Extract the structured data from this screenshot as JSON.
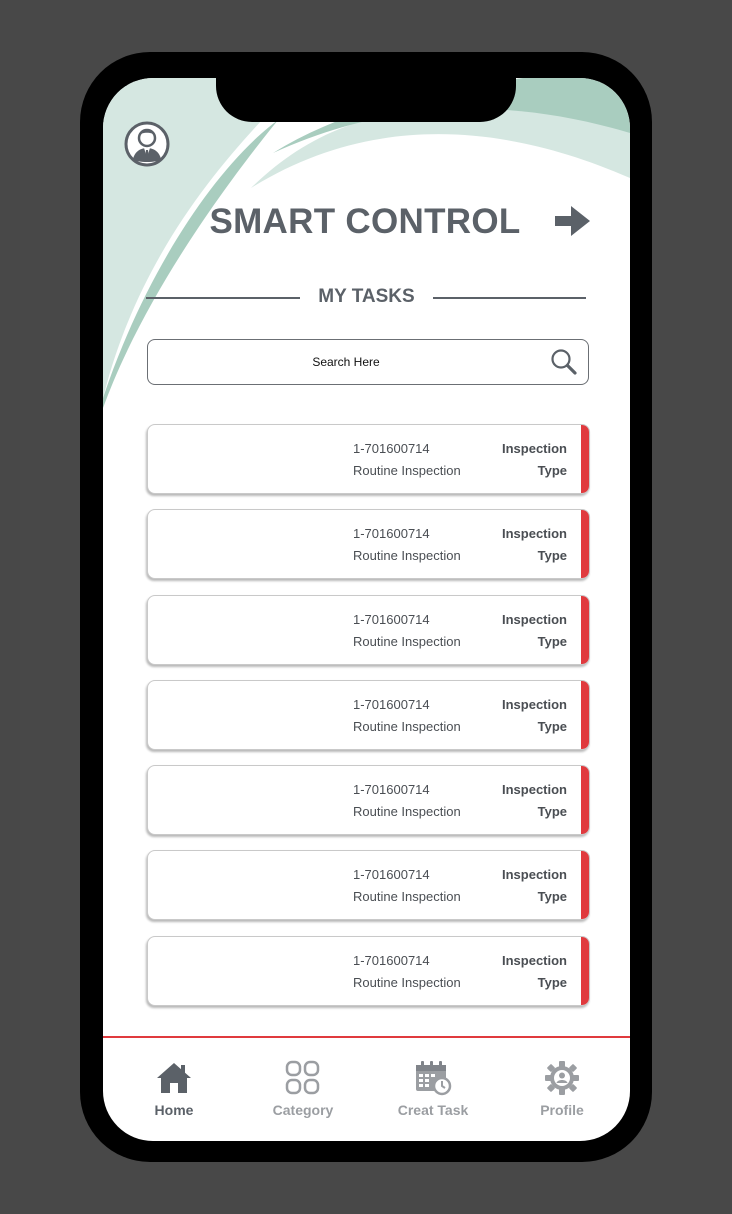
{
  "header": {
    "title": "SMART CONTROL",
    "avatar_icon": "user-avatar-icon",
    "arrow_icon": "arrow-right-icon"
  },
  "section": {
    "title": "MY TASKS"
  },
  "search": {
    "placeholder": "Search Here",
    "icon": "search-icon"
  },
  "tasks": [
    {
      "id": "1-701600714",
      "title": "Routine Inspection",
      "type_line1": "Inspection",
      "type_line2": "Type"
    },
    {
      "id": "1-701600714",
      "title": "Routine Inspection",
      "type_line1": "Inspection",
      "type_line2": "Type"
    },
    {
      "id": "1-701600714",
      "title": "Routine Inspection",
      "type_line1": "Inspection",
      "type_line2": "Type"
    },
    {
      "id": "1-701600714",
      "title": "Routine Inspection",
      "type_line1": "Inspection",
      "type_line2": "Type"
    },
    {
      "id": "1-701600714",
      "title": "Routine Inspection",
      "type_line1": "Inspection",
      "type_line2": "Type"
    },
    {
      "id": "1-701600714",
      "title": "Routine Inspection",
      "type_line1": "Inspection",
      "type_line2": "Type"
    },
    {
      "id": "1-701600714",
      "title": "Routine Inspection",
      "type_line1": "Inspection",
      "type_line2": "Type"
    }
  ],
  "nav": {
    "items": [
      {
        "label": "Home",
        "icon": "home-icon",
        "active": true
      },
      {
        "label": "Category",
        "icon": "category-grid-icon",
        "active": false
      },
      {
        "label": "Creat Task",
        "icon": "calendar-clock-icon",
        "active": false
      },
      {
        "label": "Profile",
        "icon": "profile-gear-icon",
        "active": false
      }
    ]
  },
  "colors": {
    "text_dark": "#5b6168",
    "accent_red": "#e03a3e",
    "mint_light": "#d5e7e1",
    "mint_mid": "#a9cdbf",
    "nav_inactive": "#9b9ea2"
  }
}
